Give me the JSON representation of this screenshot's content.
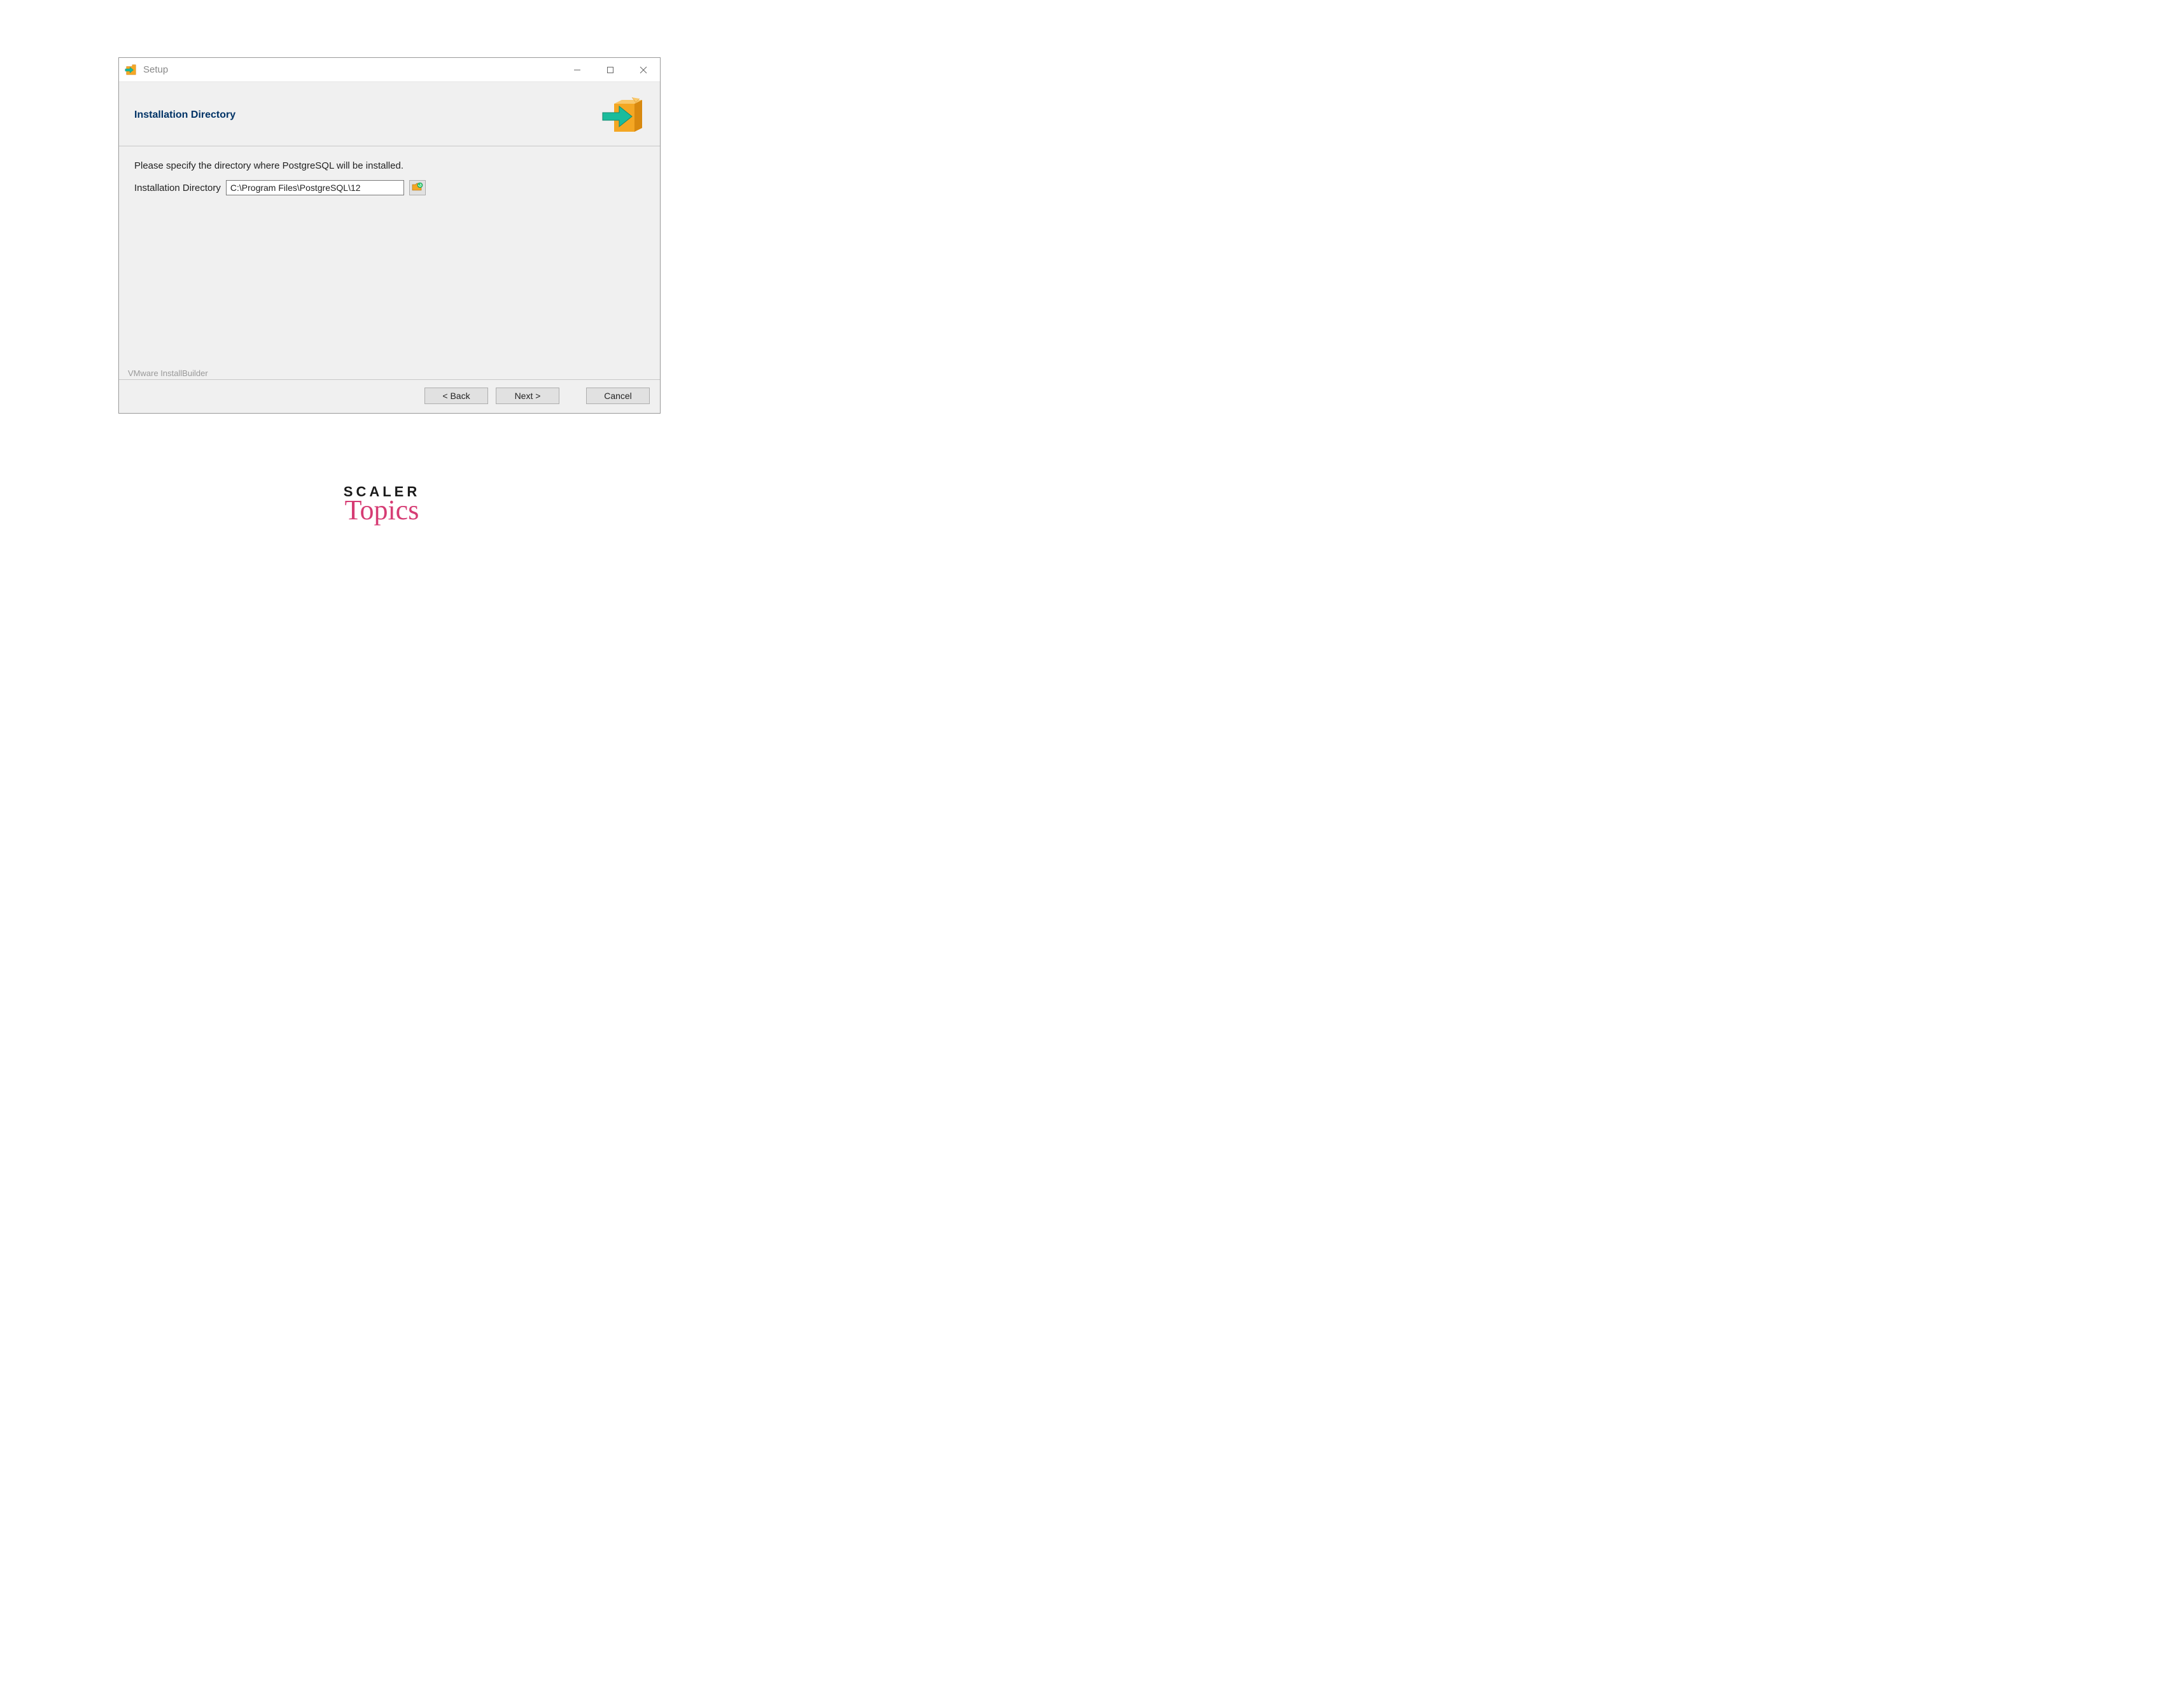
{
  "window": {
    "title": "Setup"
  },
  "header": {
    "title": "Installation Directory"
  },
  "content": {
    "instruction": "Please specify the directory where PostgreSQL will be installed.",
    "field_label": "Installation Directory",
    "field_value": "C:\\Program Files\\PostgreSQL\\12",
    "builder_label": "VMware InstallBuilder"
  },
  "footer": {
    "back_label": "< Back",
    "next_label": "Next >",
    "cancel_label": "Cancel"
  },
  "branding": {
    "line1": "SCALER",
    "line2": "Topics"
  }
}
